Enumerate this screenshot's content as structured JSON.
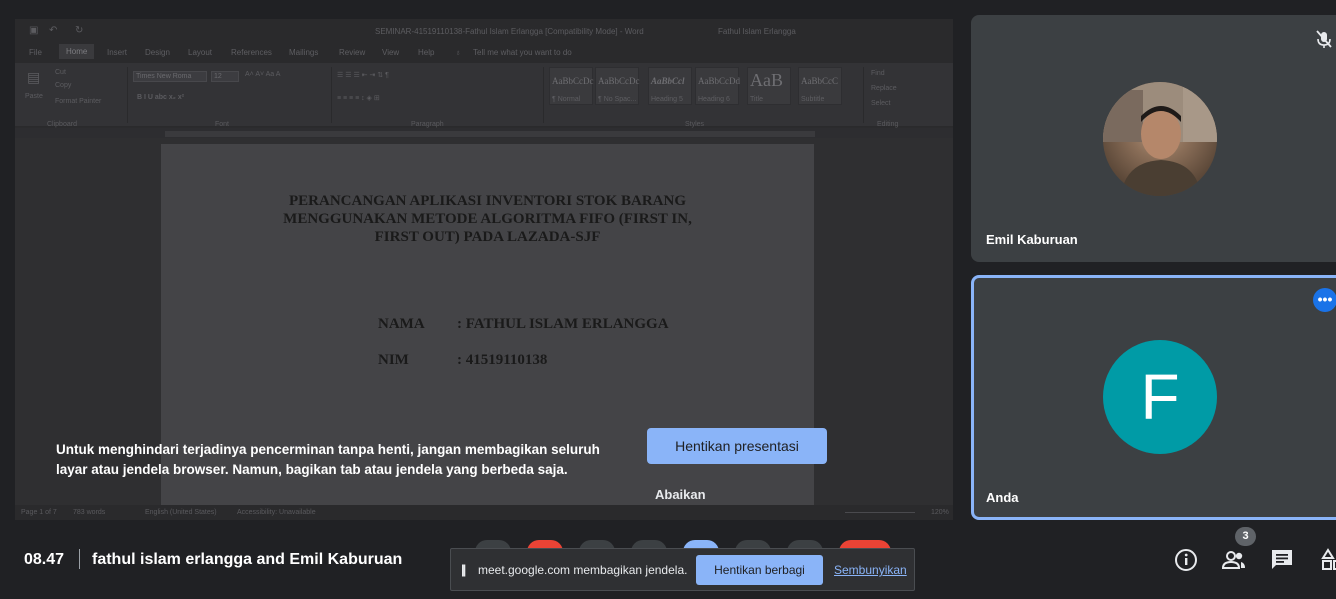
{
  "shared_window": {
    "title": "SEMINAR-41519110138-Fathul Islam Erlangga [Compatibility Mode] - Word",
    "user": "Fathul Islam Erlangga",
    "menu": [
      "File",
      "Home",
      "Insert",
      "Design",
      "Layout",
      "References",
      "Mailings",
      "Review",
      "View",
      "Help",
      "Tell me what you want to do"
    ],
    "ribbon": {
      "paste": "Paste",
      "cut": "Cut",
      "copy": "Copy",
      "format_painter": "Format Painter",
      "font_name": "Times New Roma",
      "font_size": "12",
      "styles": [
        {
          "sample": "AaBbCcDc",
          "name": "¶ Normal"
        },
        {
          "sample": "AaBbCcDc",
          "name": "¶ No Spac..."
        },
        {
          "sample": "AaBbCcl",
          "name": "Heading 5"
        },
        {
          "sample": "AaBbCcDd",
          "name": "Heading 6"
        },
        {
          "sample": "AaB",
          "name": "Title"
        },
        {
          "sample": "AaBbCcC",
          "name": "Subtitle"
        }
      ],
      "find": "Find",
      "replace": "Replace",
      "select": "Select",
      "groups": [
        "Clipboard",
        "Font",
        "Paragraph",
        "Styles",
        "Editing"
      ]
    },
    "document": {
      "title_lines": [
        "PERANCANGAN APLIKASI INVENTORI STOK BARANG",
        "MENGGUNAKAN METODE ALGORITMA FIFO (FIRST IN,",
        "FIRST OUT) PADA LAZADA-SJF"
      ],
      "nama_label": "NAMA",
      "nama_value": ": FATHUL ISLAM ERLANGGA",
      "nim_label": "NIM",
      "nim_value": ": 41519110138"
    },
    "status": {
      "page": "Page 1 of 7",
      "words": "783 words",
      "language": "English (United States)",
      "accessibility": "Accessibility: Unavailable",
      "zoom": "120%"
    }
  },
  "warning": {
    "text": "Untuk menghindari terjadinya pencerminan tanpa henti, jangan membagikan seluruh layar atau jendela browser. Namun, bagikan tab atau jendela yang berbeda saja.",
    "stop_presenting": "Hentikan presentasi",
    "ignore": "Abaikan"
  },
  "participants": [
    {
      "name": "Emil Kaburuan",
      "muted": true
    },
    {
      "name": "Anda",
      "initial": "F",
      "avatar_color": "#009ba6"
    }
  ],
  "bottom_bar": {
    "time": "08.47",
    "meeting_title": "fathul islam erlangga and Emil Kaburuan",
    "participant_count": "3"
  },
  "share_notice": {
    "message": "meet.google.com membagikan jendela.",
    "stop_sharing": "Hentikan berbagi",
    "hide": "Sembunyikan"
  },
  "colors": {
    "background": "#202124",
    "tile": "#3c4043",
    "accent": "#8ab4f8",
    "avatar": "#009ba6",
    "more_button": "#1a73e8"
  }
}
